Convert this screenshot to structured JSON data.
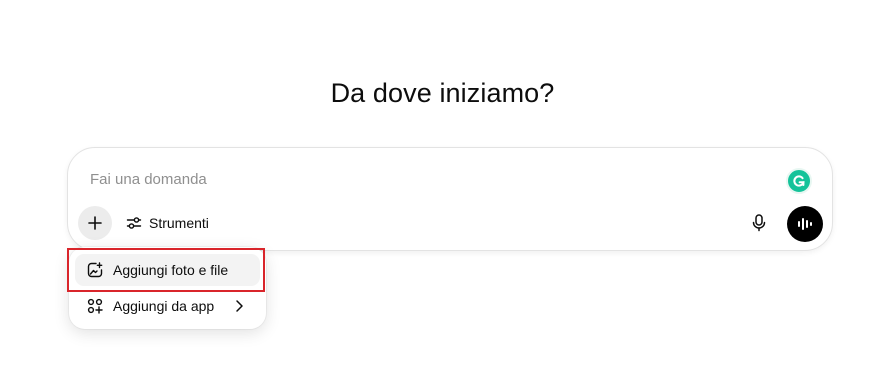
{
  "heading": "Da dove iniziamo?",
  "composer": {
    "placeholder": "Fai una domanda",
    "tools_label": "Strumenti"
  },
  "attach_menu": {
    "items": [
      {
        "label": "Aggiungi foto e file",
        "icon": "add-photo-icon"
      },
      {
        "label": "Aggiungi da app",
        "icon": "apps-icon",
        "has_submenu": true
      }
    ],
    "highlighted_index": 0
  },
  "colors": {
    "highlight": "#d9252b",
    "grammarly": "#15c39a",
    "voice_button": "#000000"
  }
}
